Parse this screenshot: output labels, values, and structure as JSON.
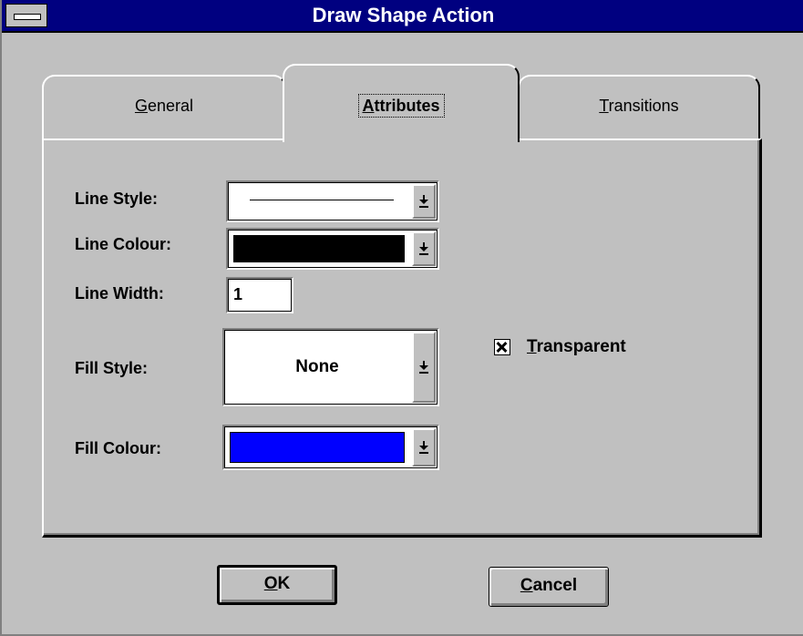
{
  "window": {
    "title": "Draw Shape Action",
    "system_menu_icon": "system-menu-icon"
  },
  "tabs": [
    {
      "label_pre": "",
      "label_accel": "G",
      "label_post": "eneral",
      "selected": false
    },
    {
      "label_pre": "",
      "label_accel": "A",
      "label_post": "ttributes",
      "selected": true
    },
    {
      "label_pre": "",
      "label_accel": "T",
      "label_post": "ransitions",
      "selected": false
    }
  ],
  "attributes": {
    "line_style_label": "Line Style:",
    "line_colour_label": "Line Colour:",
    "line_colour_value": "#000000",
    "line_width_label": "Line Width:",
    "line_width_value": "1",
    "fill_style_label": "Fill Style:",
    "fill_style_value": "None",
    "fill_colour_label": "Fill Colour:",
    "fill_colour_value": "#0000ff",
    "transparent_label_accel": "T",
    "transparent_label_rest": "ransparent",
    "transparent_checked": true,
    "dropdown_icon": "dropdown-arrow-icon"
  },
  "buttons": {
    "ok_accel": "O",
    "ok_rest": "K",
    "cancel_accel": "C",
    "cancel_rest": "ancel"
  }
}
